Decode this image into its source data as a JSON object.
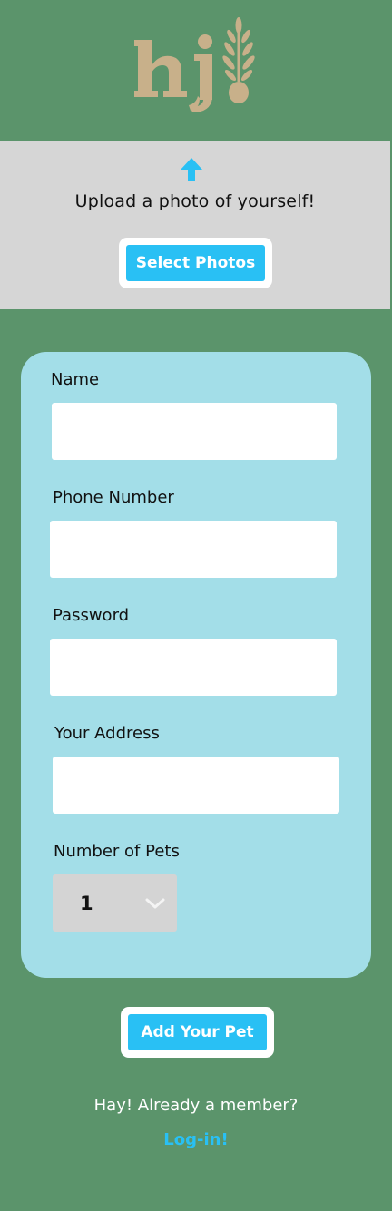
{
  "brand": {
    "logo_text": "hj!",
    "logo_color": "#c8b08a"
  },
  "upload": {
    "icon": "upload-arrow-icon",
    "prompt": "Upload a photo of yourself!",
    "select_label": "Select Photos"
  },
  "form": {
    "name_label": "Name",
    "name_value": "",
    "phone_label": "Phone Number",
    "phone_value": "",
    "password_label": "Password",
    "password_value": "",
    "address_label": "Your Address",
    "address_value": "",
    "pets_label": "Number of Pets",
    "pets_value": "1",
    "pets_icon": "chevron-down-icon"
  },
  "actions": {
    "add_pet_label": "Add Your Pet",
    "member_prompt": "Hay! Already a member?",
    "login_label": "Log-in!"
  },
  "colors": {
    "background": "#5b946b",
    "panel": "#d6d6d6",
    "card": "#a3dee8",
    "accent": "#29c0f4"
  }
}
